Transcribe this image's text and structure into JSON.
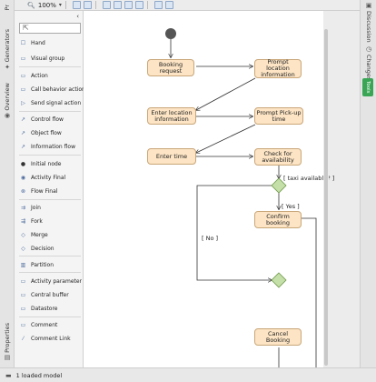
{
  "toolbar": {
    "zoom": "100%"
  },
  "left_tabs": {
    "top": "Pr",
    "generators": "Generators",
    "overview": "Overview",
    "properties": "Properties"
  },
  "palette": {
    "items": [
      {
        "label": "Hand",
        "icon": "hand-icon"
      },
      {
        "label": "Visual group",
        "icon": "visual-group-icon"
      },
      {
        "label": "Action",
        "icon": "action-icon"
      },
      {
        "label": "Call behavior action",
        "icon": "call-behavior-action-icon"
      },
      {
        "label": "Send signal action",
        "icon": "send-signal-action-icon"
      },
      {
        "label": "Control flow",
        "icon": "control-flow-icon"
      },
      {
        "label": "Object flow",
        "icon": "object-flow-icon"
      },
      {
        "label": "Information flow",
        "icon": "information-flow-icon"
      },
      {
        "label": "Initial node",
        "icon": "initial-node-icon"
      },
      {
        "label": "Activity Final",
        "icon": "activity-final-icon"
      },
      {
        "label": "Flow Final",
        "icon": "flow-final-icon"
      },
      {
        "label": "Join",
        "icon": "join-icon"
      },
      {
        "label": "Fork",
        "icon": "fork-icon"
      },
      {
        "label": "Merge",
        "icon": "merge-icon"
      },
      {
        "label": "Decision",
        "icon": "decision-icon"
      },
      {
        "label": "Partition",
        "icon": "partition-icon"
      },
      {
        "label": "Activity parameter",
        "icon": "activity-parameter-icon"
      },
      {
        "label": "Central buffer",
        "icon": "central-buffer-icon"
      },
      {
        "label": "Datastore",
        "icon": "datastore-icon"
      },
      {
        "label": "Comment",
        "icon": "comment-icon"
      },
      {
        "label": "Comment Link",
        "icon": "comment-link-icon"
      }
    ]
  },
  "diagram": {
    "nodes": {
      "booking_request": "Booking request",
      "prompt_location": "Prompt location information",
      "enter_location": "Enter location information",
      "prompt_pickup": "Prompt Pick-up time",
      "enter_time": "Enter time",
      "check_availability": "Check for availability",
      "confirm_booking": "Confirm booking",
      "cancel_booking": "Cancel Booking"
    },
    "guards": {
      "taxi_available": "[ taxi available? ]",
      "yes": "[ Yes ]",
      "no": "[ No ]"
    }
  },
  "right_tabs": {
    "discussion": "Discussion",
    "changes": "Changes",
    "tools": "Tools"
  },
  "status": {
    "models": "1 loaded model"
  },
  "colors": {
    "node_fill": "#fce4c4",
    "node_border": "#c9a77a",
    "decision_fill": "#c5dfa8",
    "tools_badge": "#3aa655"
  }
}
